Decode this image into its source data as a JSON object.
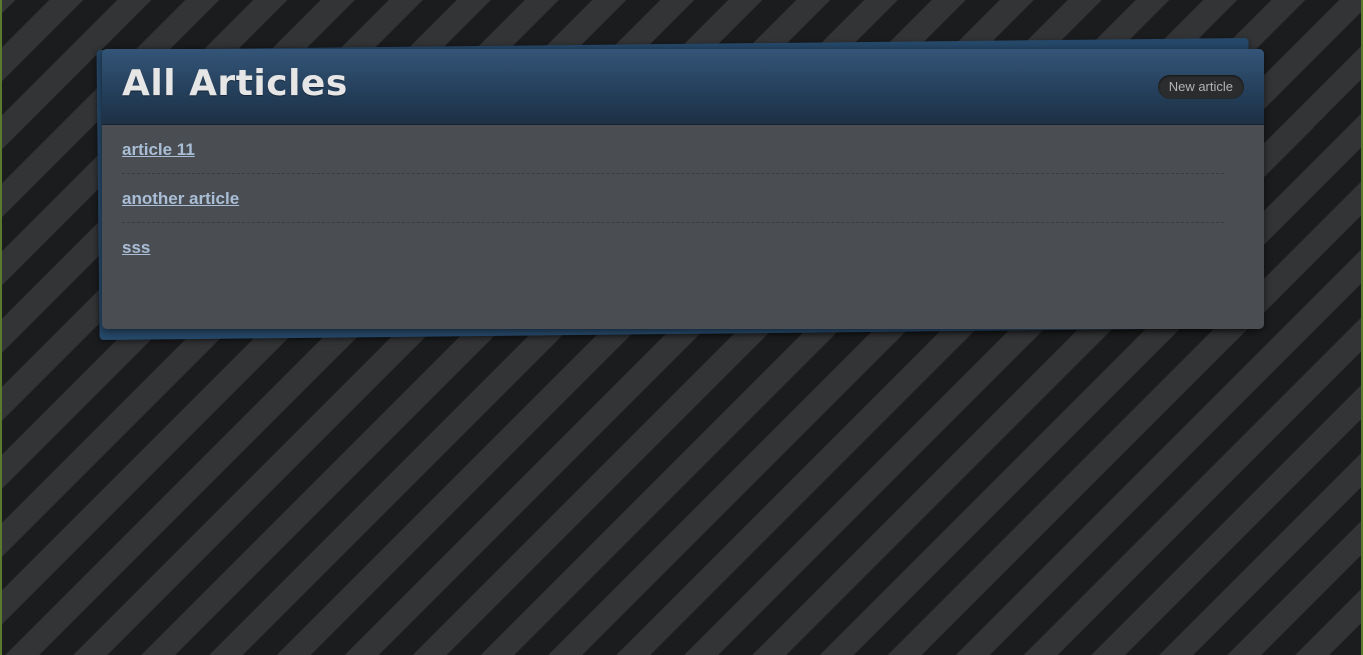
{
  "header": {
    "title": "All Articles",
    "new_article_label": "New article"
  },
  "articles": [
    {
      "title": "article 11"
    },
    {
      "title": "another article"
    },
    {
      "title": "sss"
    }
  ],
  "colors": {
    "header_accent": "#2c4a6b",
    "panel_bg": "#4a4e52",
    "link": "#a9bed6"
  }
}
